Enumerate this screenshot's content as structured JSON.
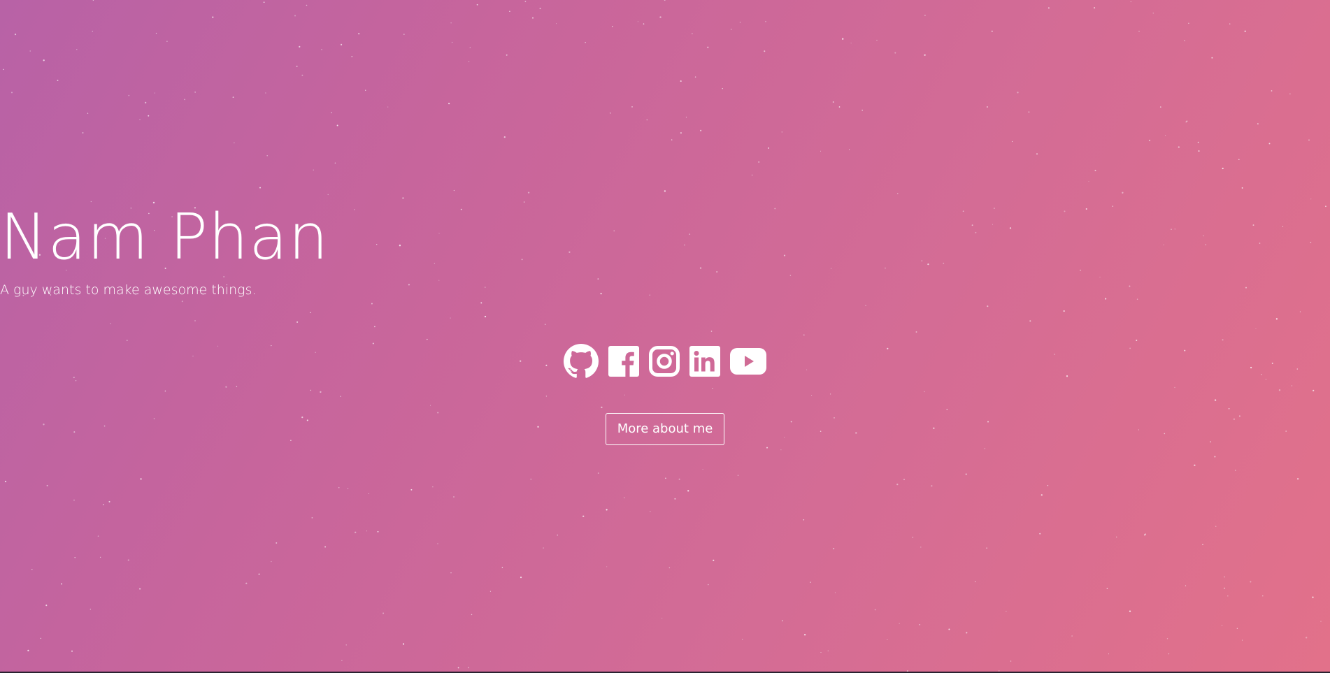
{
  "hero": {
    "name": "Nam Phan",
    "tagline": "A guy wants to make awesome things.",
    "button_label": "More about me",
    "colors": {
      "gradient_start": "#b862a6",
      "gradient_end": "#e2718a",
      "text": "#ffffff"
    }
  },
  "socials": [
    {
      "icon": "github-icon"
    },
    {
      "icon": "facebook-icon"
    },
    {
      "icon": "instagram-icon"
    },
    {
      "icon": "linkedin-icon"
    },
    {
      "icon": "youtube-icon"
    }
  ]
}
